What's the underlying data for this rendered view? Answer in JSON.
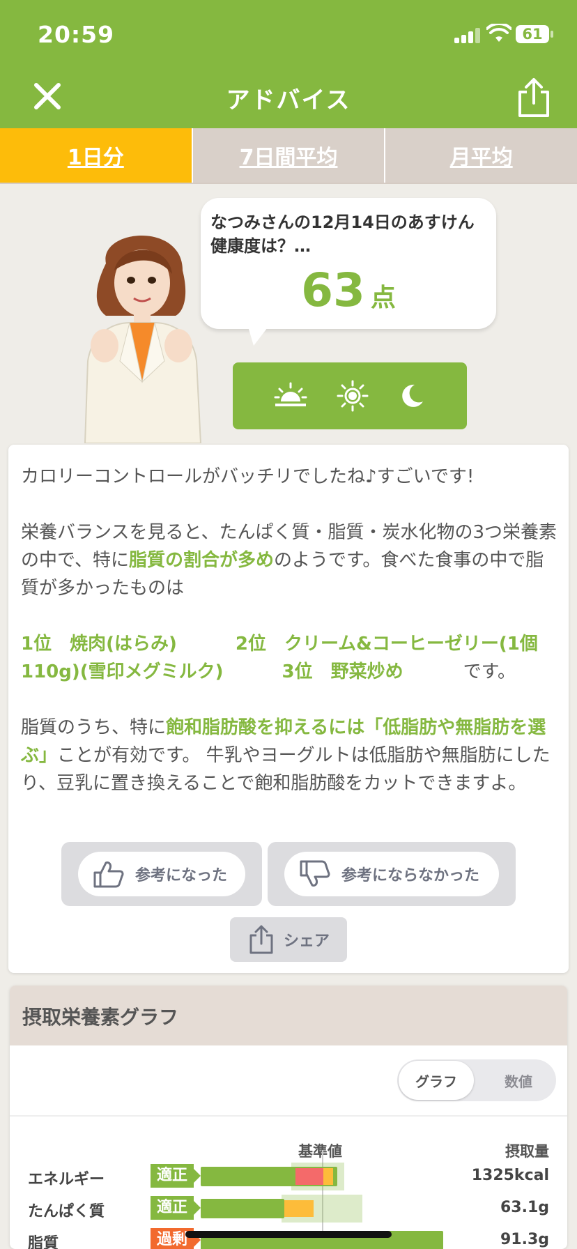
{
  "status_bar": {
    "time": "20:59",
    "battery": "61"
  },
  "nav": {
    "title": "アドバイス"
  },
  "tabs": [
    {
      "label": "1日分",
      "active": true
    },
    {
      "label": "7日間平均",
      "active": false
    },
    {
      "label": "月平均",
      "active": false
    }
  ],
  "bubble": {
    "question": "なつみさんの12月14日のあすけん健康度は？…",
    "score": "63",
    "score_unit": "点"
  },
  "meal_icons": [
    "sunrise-icon",
    "sun-icon",
    "moon-icon"
  ],
  "advice": {
    "p1": "カロリーコントロールがバッチリでしたね♪すごいです!",
    "p2_a": "栄養バランスを見ると、たんぱく質・脂質・炭水化物の3つ栄養素の中で、特に",
    "p2_hl": "脂質の割合が多め",
    "p2_b": "のようです。食べた食事の中で脂質が多かったものは",
    "rank1": "1位　焼肉(はらみ)",
    "rank2": "2位　クリーム&コーヒーゼリー(1個110g)(雪印メグミルク)",
    "rank3": "3位　野菜炒め",
    "rank_tail": "です。",
    "p3_a": "脂質のうち、特に",
    "p3_hl": "飽和脂肪酸を抑えるには「低脂肪や無脂肪を選ぶ」",
    "p3_b": "ことが有効です。 牛乳やヨーグルトは低脂肪や無脂肪にしたり、豆乳に置き換えることで飽和脂肪酸をカットできますよ。"
  },
  "feedback": {
    "helpful": "参考になった",
    "not_helpful": "参考にならなかった",
    "share": "シェア"
  },
  "nutrients": {
    "title": "摂取栄養素グラフ",
    "toggle_graph": "グラフ",
    "toggle_value": "数値",
    "col_standard": "基準値",
    "col_intake": "摂取量",
    "rows": [
      {
        "name": "エネルギー",
        "status": "適正",
        "value": "1325kcal"
      },
      {
        "name": "たんぱく質",
        "status": "適正",
        "value": "63.1g"
      },
      {
        "name": "脂質",
        "status": "過剰",
        "value": "91.3g"
      }
    ]
  },
  "colors": {
    "brand_green": "#85b840",
    "tab_active": "#fdbc0a",
    "tab_inactive": "#d9d0c9",
    "over": "#f26a2e"
  }
}
